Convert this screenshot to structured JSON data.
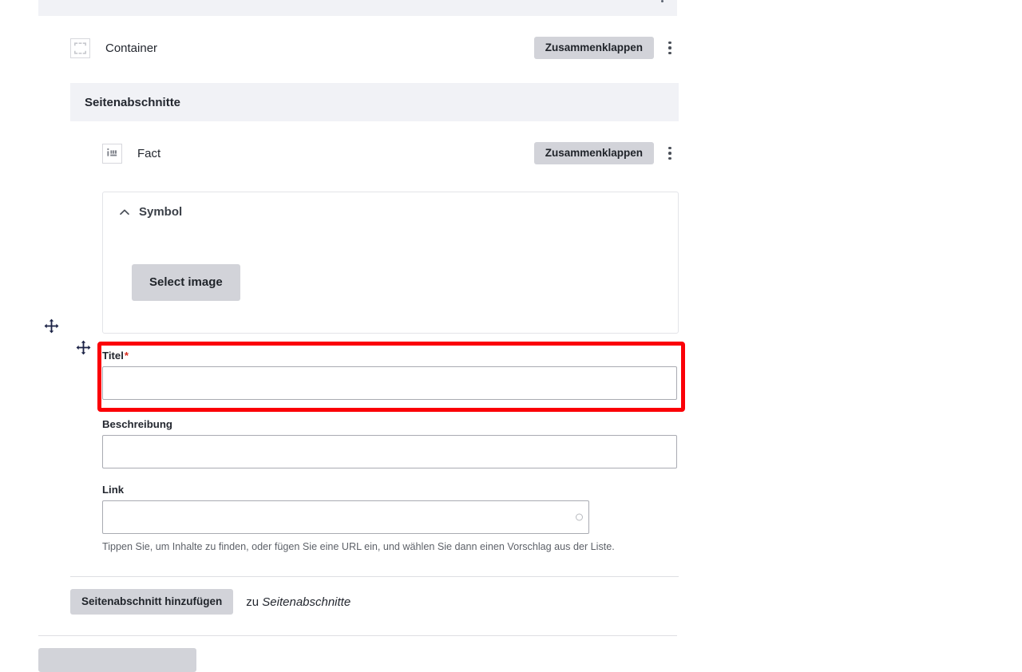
{
  "window": {
    "language": "de"
  },
  "top_band": {
    "kebab_icon": "kebab-menu-icon"
  },
  "container_row": {
    "icon": "container-icon",
    "label": "Container",
    "collapse_label": "Zusammenklappen",
    "kebab_icon": "kebab-menu-icon"
  },
  "section_band": {
    "title": "Seitenabschnitte"
  },
  "fact_row": {
    "icon": "fact-info-icon",
    "label": "Fact",
    "collapse_label": "Zusammenklappen",
    "kebab_icon": "kebab-menu-icon"
  },
  "symbol_panel": {
    "chevron_icon": "chevron-up-icon",
    "title": "Symbol",
    "select_image_label": "Select image"
  },
  "fields": {
    "titel": {
      "label": "Titel",
      "required_marker": "*",
      "value": "",
      "placeholder": "",
      "highlighted": true,
      "highlight_color": "#fb0007"
    },
    "beschreibung": {
      "label": "Beschreibung",
      "value": "",
      "placeholder": ""
    },
    "link": {
      "label": "Link",
      "value": "",
      "placeholder": "",
      "spinner_icon": "loading-circle-icon",
      "hint": "Tippen Sie, um Inhalte zu finden, oder fügen Sie eine URL ein, und wählen Sie dann einen Vorschlag aus der Liste."
    }
  },
  "add_section": {
    "button_label": "Seitenabschnitt hinzufügen",
    "tail_prefix": "zu",
    "tail_target": "Seitenabschnitte"
  },
  "cursors": {
    "move_icon": "move-cursor-icon",
    "move_icon_color": "#1b2246"
  },
  "theme": {
    "band_bg": "#f1f2f6",
    "button_bg": "#d2d3d9",
    "text": "#23272f",
    "border": "#dedfe3"
  }
}
